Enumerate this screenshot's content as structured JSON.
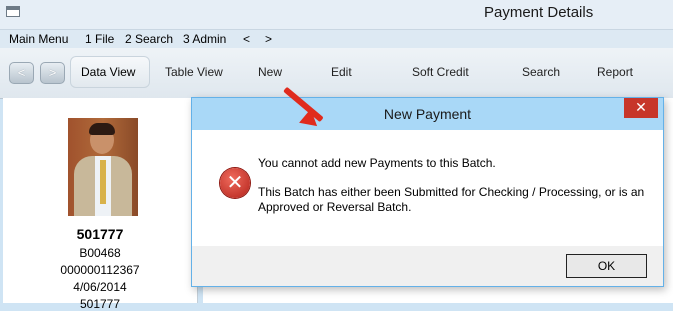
{
  "window": {
    "title": "Payment Details"
  },
  "menu": {
    "items": [
      "Main Menu",
      "1 File",
      "2 Search",
      "3 Admin",
      "<",
      ">"
    ]
  },
  "toolbar": {
    "back_glyph": "<",
    "forward_glyph": ">",
    "items": [
      "Data View",
      "Table View",
      "New",
      "Edit",
      "Soft Credit",
      "Search",
      "Report"
    ]
  },
  "record": {
    "id": "501777",
    "batch": "B00468",
    "number": "000000112367",
    "date": "4/06/2014",
    "extra": "501777"
  },
  "dialog": {
    "title": "New Payment",
    "close_glyph": "✕",
    "icon": "error-icon",
    "message_primary": "You cannot add new Payments to this Batch.",
    "message_secondary": "This Batch has either been Submitted for Checking / Processing, or is an Approved or Reversal Batch.",
    "ok_label": "OK"
  },
  "annotation": {
    "color": "#e02b1d"
  }
}
